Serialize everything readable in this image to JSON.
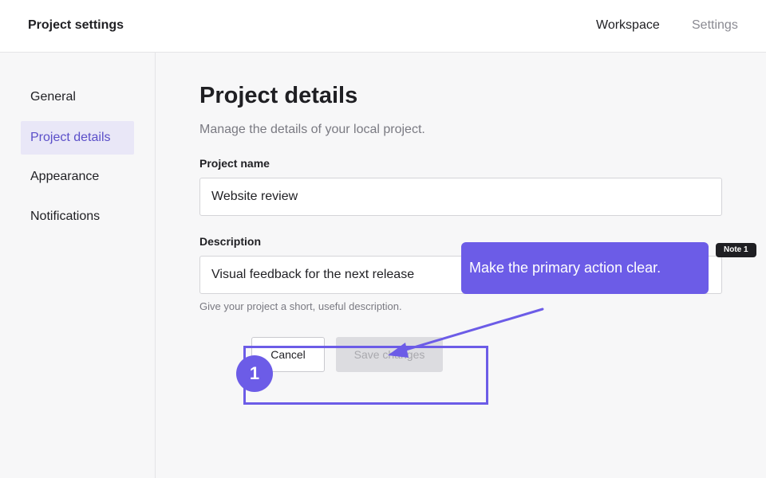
{
  "header": {
    "title": "Project settings",
    "nav": {
      "workspace": "Workspace",
      "settings": "Settings"
    }
  },
  "sidebar": {
    "items": [
      {
        "label": "General",
        "active": false
      },
      {
        "label": "Project details",
        "active": true
      },
      {
        "label": "Appearance",
        "active": false
      },
      {
        "label": "Notifications",
        "active": false
      }
    ]
  },
  "main": {
    "title": "Project details",
    "subtitle": "Manage the details of your local project.",
    "project_name": {
      "label": "Project name",
      "value": "Website review"
    },
    "description": {
      "label": "Description",
      "value": "Visual feedback for the next release",
      "help": "Give your project a short, useful description."
    },
    "actions": {
      "cancel": "Cancel",
      "save": "Save changes"
    }
  },
  "annotation": {
    "badge": "1",
    "note_tag": "Note 1",
    "callout": "Make the primary action clear."
  },
  "colors": {
    "accent": "#6c5ce7",
    "active_nav_bg": "#e9e7f7",
    "active_nav_text": "#5b4fc9",
    "disabled_button": "#dcdce0"
  }
}
